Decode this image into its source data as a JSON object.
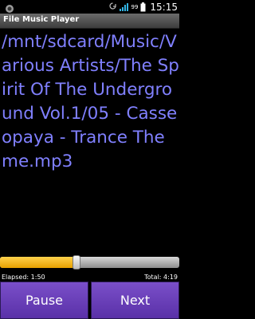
{
  "status_bar": {
    "time": "15:15",
    "battery_level": "99",
    "icons": [
      "notification-icon",
      "usb-sync-icon",
      "signal-icon",
      "battery-icon"
    ]
  },
  "app": {
    "title": "File Music Player"
  },
  "track": {
    "path": "/mnt/sdcard/Music/Various Artists/The Spirit Of The Underground Vol.1/05 - Casseopaya - Trance Theme.mp3"
  },
  "playback": {
    "elapsed_label": "Elapsed: 1:50",
    "total_label": "Total: 4:19",
    "progress_fraction": 0.425
  },
  "buttons": {
    "pause_label": "Pause",
    "next_label": "Next"
  },
  "colors": {
    "path_text": "#8080ff",
    "progress_fill": "#f2b300",
    "button_bg": "#6a40b8"
  }
}
